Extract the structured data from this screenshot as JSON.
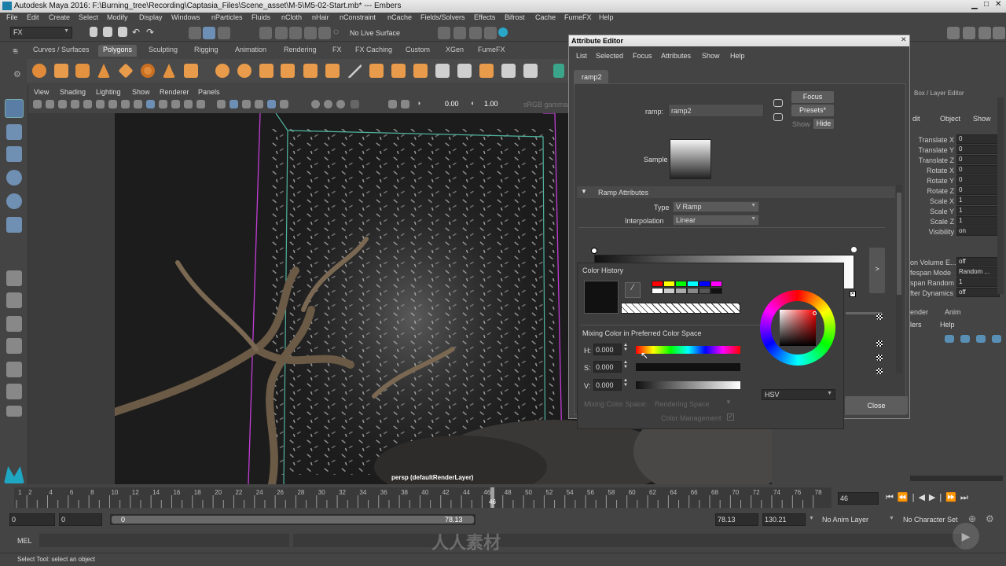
{
  "window": {
    "title": "Autodesk Maya 2016: F:\\Burning_tree\\Recording\\Captasia_Files\\Scene_asset\\M-5\\M5-02-Start.mb*  ---  Embers"
  },
  "menubar": [
    "File",
    "Edit",
    "Create",
    "Select",
    "Modify",
    "Display",
    "Windows",
    "nParticles",
    "Fluids",
    "nCloth",
    "nHair",
    "nConstraint",
    "nCache",
    "Fields/Solvers",
    "Effects",
    "Bifrost",
    "Cache",
    "FumeFX",
    "Help"
  ],
  "statusline": {
    "menuset": "FX",
    "live_surface": "No Live Surface"
  },
  "shelf_tabs": [
    "Curves / Surfaces",
    "Polygons",
    "Sculpting",
    "Rigging",
    "Animation",
    "Rendering",
    "FX",
    "FX Caching",
    "Custom",
    "XGen",
    "FumeFX"
  ],
  "shelf_active": "Polygons",
  "panel_menu": [
    "View",
    "Shading",
    "Lighting",
    "Show",
    "Renderer",
    "Panels"
  ],
  "panel_toolbar": {
    "exposure": "0.00",
    "gamma": "1.00",
    "color_space": "sRGB gamma"
  },
  "viewport": {
    "label": "persp (defaultRenderLayer)"
  },
  "attr_editor": {
    "title": "Attribute Editor",
    "menus": [
      "List",
      "Selected",
      "Focus",
      "Attributes",
      "Show",
      "Help"
    ],
    "tab": "ramp2",
    "ramp_label": "ramp:",
    "ramp_value": "ramp2",
    "focus_btn": "Focus",
    "presets_btn": "Presets*",
    "show_btn": "Show",
    "hide_btn": "Hide",
    "sample_label": "Sample",
    "section": "Ramp Attributes",
    "type_label": "Type",
    "type_value": "V Ramp",
    "interp_label": "Interpolation",
    "interp_value": "Linear",
    "close_btn": "Close",
    "arrow_btn": ">"
  },
  "color_chooser": {
    "history_label": "Color History",
    "mixing_label": "Mixing Color in Preferred Color Space",
    "h_label": "H:",
    "h_value": "0.000",
    "s_label": "S:",
    "s_value": "0.000",
    "v_label": "V:",
    "v_value": "0.000",
    "mixing_space_label": "Mixing Color Space:",
    "mixing_space_value": "Rendering Space",
    "color_mgmt_label": "Color Management",
    "mode_value": "HSV",
    "swatches": [
      "#ff0000",
      "#ffff00",
      "#00ff00",
      "#00ffff",
      "#0000ff",
      "#ff00ff",
      "#ffffff",
      "#dddddd",
      "#bbbbbb",
      "#999999",
      "#777777",
      "#555555",
      "#333333",
      "#000000"
    ]
  },
  "channel_box": {
    "header": "Box / Layer Editor",
    "menus": [
      "dit",
      "Object",
      "Show"
    ],
    "channels": [
      {
        "name": "Translate X",
        "value": "0"
      },
      {
        "name": "Translate Y",
        "value": "0"
      },
      {
        "name": "Translate Z",
        "value": "0"
      },
      {
        "name": "Rotate X",
        "value": "0"
      },
      {
        "name": "Rotate Y",
        "value": "0"
      },
      {
        "name": "Rotate Z",
        "value": "0"
      },
      {
        "name": "Scale X",
        "value": "1"
      },
      {
        "name": "Scale Y",
        "value": "1"
      },
      {
        "name": "Scale Z",
        "value": "1"
      },
      {
        "name": "Visibility",
        "value": "on"
      }
    ],
    "extra": [
      {
        "name": "on Volume E...",
        "value": "off"
      },
      {
        "name": "fespan Mode",
        "value": "Random ..."
      },
      {
        "name": "span Random",
        "value": "1"
      },
      {
        "name": "fter Dynamics",
        "value": "off"
      }
    ],
    "layer_tabs": [
      "ender",
      "Anim"
    ],
    "layer_menus": [
      "lers",
      "Help"
    ]
  },
  "timeline": {
    "ticks": [
      "1",
      "2",
      "4",
      "6",
      "8",
      "10",
      "12",
      "14",
      "16",
      "18",
      "20",
      "22",
      "24",
      "26",
      "28",
      "30",
      "32",
      "34",
      "36",
      "38",
      "40",
      "42",
      "44",
      "46",
      "48",
      "50",
      "52",
      "54",
      "56",
      "58",
      "60",
      "62",
      "64",
      "66",
      "68",
      "70",
      "72",
      "74",
      "76",
      "78"
    ],
    "current_frame": "46",
    "current_field": "46"
  },
  "range": {
    "start": "0",
    "start2": "0",
    "slider_start": "0",
    "slider_end": "78.13",
    "end": "78.13",
    "end2": "130.21",
    "anim_layer": "No Anim Layer",
    "char_set": "No Character Set"
  },
  "mel": {
    "label": "MEL"
  },
  "helpline": "Select Tool: select an object",
  "watermark": "人人素材"
}
